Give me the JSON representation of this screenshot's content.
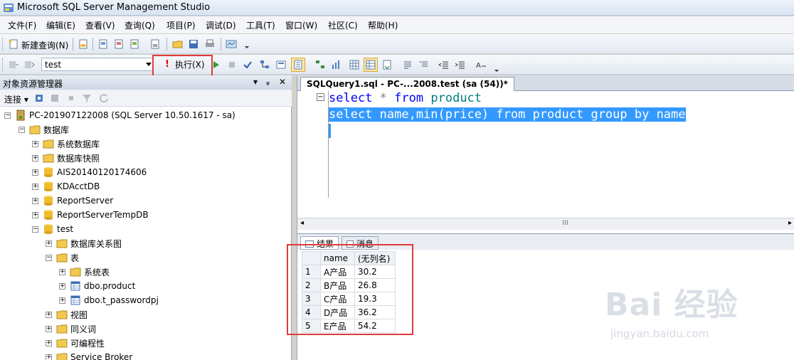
{
  "window": {
    "title": "Microsoft SQL Server Management Studio"
  },
  "menu": [
    "文件(F)",
    "编辑(E)",
    "查看(V)",
    "查询(Q)",
    "项目(P)",
    "调试(D)",
    "工具(T)",
    "窗口(W)",
    "社区(C)",
    "帮助(H)"
  ],
  "toolbar": {
    "new_query_label": "新建查询(N)",
    "database_value": "test",
    "execute_label": "执行(X)"
  },
  "explorer": {
    "title": "对象资源管理器",
    "pin": "ᵩ",
    "close": "✕",
    "connect_label": "连接",
    "tree": [
      {
        "label": "PC-201907122008 (SQL Server 10.50.1617 - sa)"
      },
      {
        "label": "数据库"
      },
      {
        "label": "系统数据库"
      },
      {
        "label": "数据库快照"
      },
      {
        "label": "AIS20140120174606"
      },
      {
        "label": "KDAcctDB"
      },
      {
        "label": "ReportServer"
      },
      {
        "label": "ReportServerTempDB"
      },
      {
        "label": "test"
      },
      {
        "label": "数据库关系图"
      },
      {
        "label": "表"
      },
      {
        "label": "系统表"
      },
      {
        "label": "dbo.product"
      },
      {
        "label": "dbo.t_passwordpj"
      },
      {
        "label": "视图"
      },
      {
        "label": "同义词"
      },
      {
        "label": "可编程性"
      },
      {
        "label": "Service Broker"
      }
    ]
  },
  "editor": {
    "tab_label": "SQLQuery1.sql - PC-...2008.test (sa (54))*",
    "line1": {
      "kw1": "select",
      "op": "*",
      "kw2": "from",
      "id": "product"
    },
    "line2": "select name,min(price) from product group by name",
    "scroll_marker": "III"
  },
  "results": {
    "tab_results": "结果",
    "tab_messages": "消息",
    "columns": [
      "name",
      "(无列名)"
    ],
    "rows": [
      {
        "n": "1",
        "name": "A产品",
        "val": "30.2"
      },
      {
        "n": "2",
        "name": "B产品",
        "val": "26.8"
      },
      {
        "n": "3",
        "name": "C产品",
        "val": "19.3"
      },
      {
        "n": "4",
        "name": "D产品",
        "val": "36.2"
      },
      {
        "n": "5",
        "name": "E产品",
        "val": "54.2"
      }
    ]
  },
  "watermark": {
    "brand": "Bai 经验",
    "url": "jingyan.baidu.com"
  },
  "colors": {
    "keyword": "#0000ff",
    "identifier": "#008080",
    "selection": "#3399ff",
    "highlight_box": "#e03a3a"
  }
}
